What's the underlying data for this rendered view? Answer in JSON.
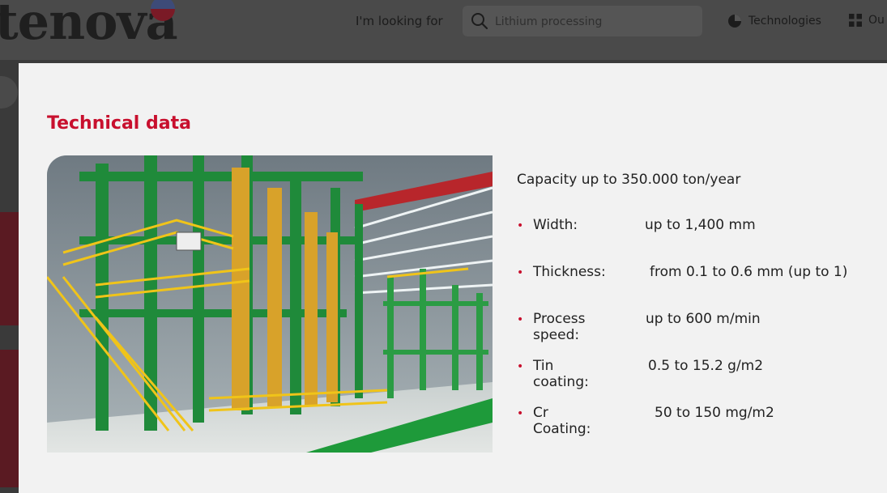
{
  "header": {
    "logo_text": "tenova",
    "looking_for_label": "I'm looking for",
    "search": {
      "placeholder": "Lithium processing",
      "value": ""
    },
    "nav": {
      "technologies_label": "Technologies",
      "our_label": "Ou"
    },
    "icons": {
      "search": "search-icon",
      "technologies": "pie-icon",
      "our": "grid-icon"
    }
  },
  "modal": {
    "title": "Technical data",
    "image_alt": "Steel processing line",
    "capacity": "Capacity up to 350.000 ton/year",
    "specs": [
      {
        "label": "Width:",
        "value": "up to 1,400 mm"
      },
      {
        "label": "Thickness:",
        "value": "from 0.1 to 0.6 mm (up to 1)"
      },
      {
        "label": "Process speed:",
        "value": "up to 600 m/min"
      },
      {
        "label": "Tin coating:",
        "value": "0.5 to 15.2 g/m2"
      },
      {
        "label": "Cr Coating:",
        "value": "50 to 150 mg/m2"
      }
    ]
  },
  "colors": {
    "accent": "#c8102e",
    "modal_bg": "#f2f2f2",
    "overlay": "#3b3b3b"
  }
}
